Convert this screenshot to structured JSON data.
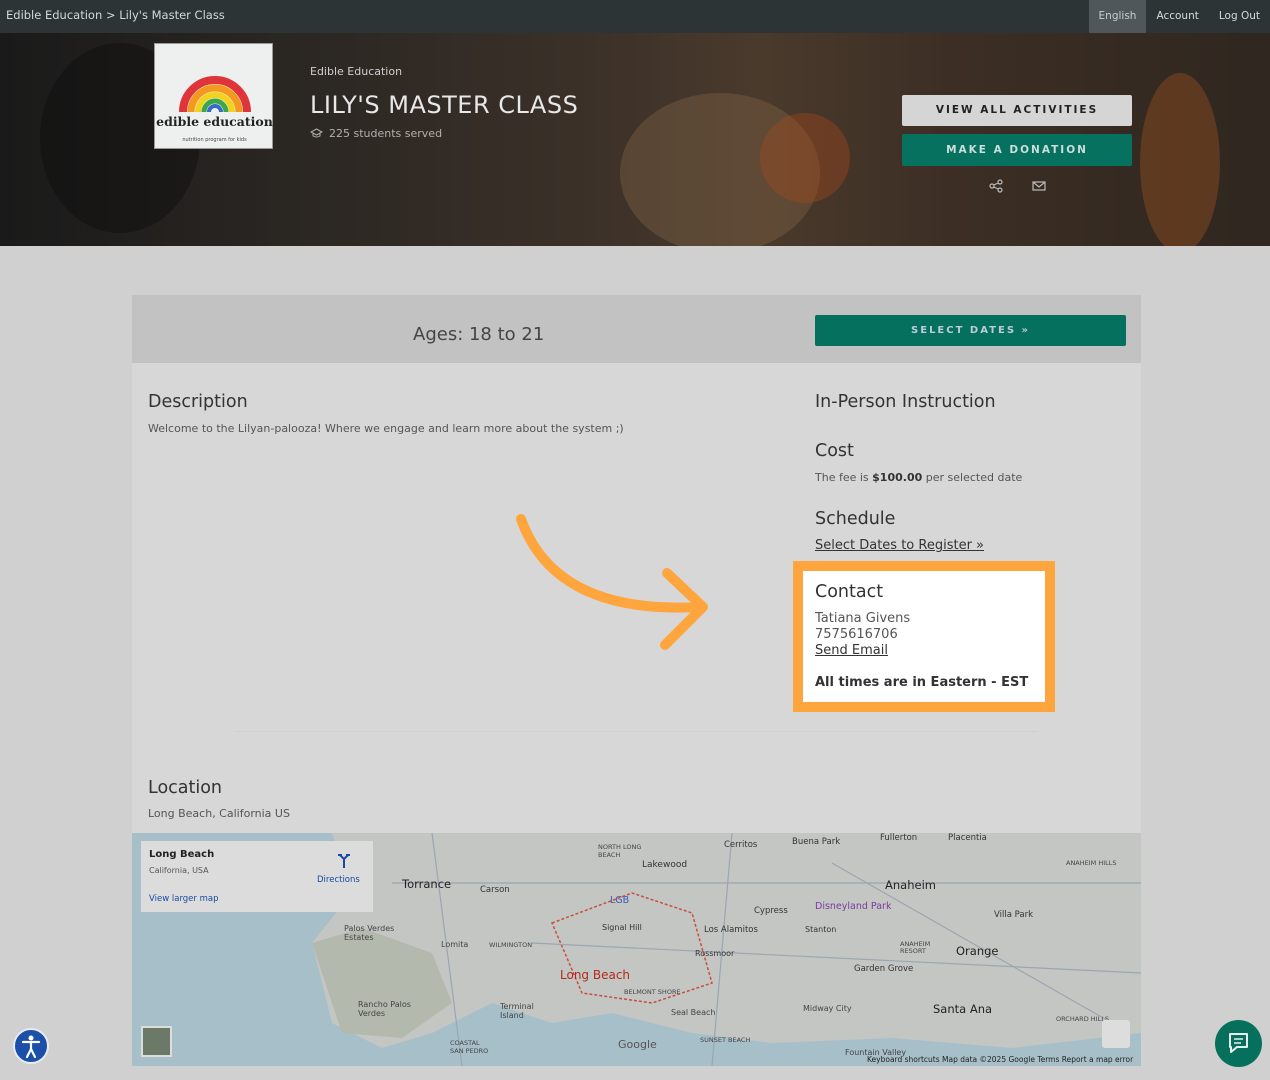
{
  "topbar": {
    "breadcrumb_root": "Edible Education",
    "breadcrumb_sep": ">",
    "breadcrumb_current": "Lily's Master Class",
    "language": "English",
    "account": "Account",
    "logout": "Log Out"
  },
  "hero": {
    "logo_text": "edible education",
    "logo_sub": "nutrition program for kids",
    "org_name": "Edible Education",
    "title": "LILY'S MASTER CLASS",
    "students_served": "225 students served",
    "view_all_label": "VIEW ALL ACTIVITIES",
    "donate_label": "MAKE A DONATION",
    "share_icon": "share-icon",
    "email_icon": "mail-icon"
  },
  "card": {
    "ages": "Ages: 18 to 21",
    "select_dates_label": "SELECT DATES »",
    "description_heading": "Description",
    "description_text": "Welcome to the Lilyan-palooza! Where we engage and learn more about the system ;)",
    "instruction_heading": "In-Person Instruction",
    "cost_heading": "Cost",
    "cost_prefix": "The fee is",
    "cost_amount": "$100.00",
    "cost_suffix": "per selected date",
    "schedule_heading": "Schedule",
    "schedule_link": "Select Dates to Register »",
    "contact_heading": "Contact",
    "contact_name": "Tatiana Givens",
    "contact_phone": "7575616706",
    "contact_email_link": "Send Email",
    "timezone_note": "All times are in Eastern - EST",
    "location_heading": "Location",
    "location_text": "Long Beach, California US"
  },
  "map": {
    "info_title": "Long Beach",
    "info_sub": "California, USA",
    "info_link": "View larger map",
    "directions": "Directions",
    "labels": [
      "Torrance",
      "Carson",
      "Lakewood",
      "Cerritos",
      "Buena Park",
      "Fullerton",
      "Placentia",
      "Anaheim",
      "Disneyland Park",
      "Cypress",
      "Los Alamitos",
      "Stanton",
      "Garden Grove",
      "Orange",
      "Villa Park",
      "Santa Ana",
      "Signal Hill",
      "Rossmoor",
      "Long Beach",
      "Palos Verdes Estates",
      "Lomita",
      "WILMINGTON",
      "Rancho Palos Verdes",
      "Terminal Island",
      "Seal Beach",
      "Midway City",
      "Fountain Valley",
      "BELMONT SHORE",
      "SUNSET BEACH",
      "COASTAL SAN PEDRO",
      "NORTH LONG BEACH",
      "ANAHEIM HILLS",
      "ANAHEIM RESORT",
      "ORCHARD HILLS",
      "LGB",
      "Google"
    ],
    "footer": "Keyboard shortcuts   Map data ©2025 Google   Terms   Report a map error"
  },
  "colors": {
    "accent_green": "#05705d",
    "highlight_orange": "#ffa53d"
  }
}
